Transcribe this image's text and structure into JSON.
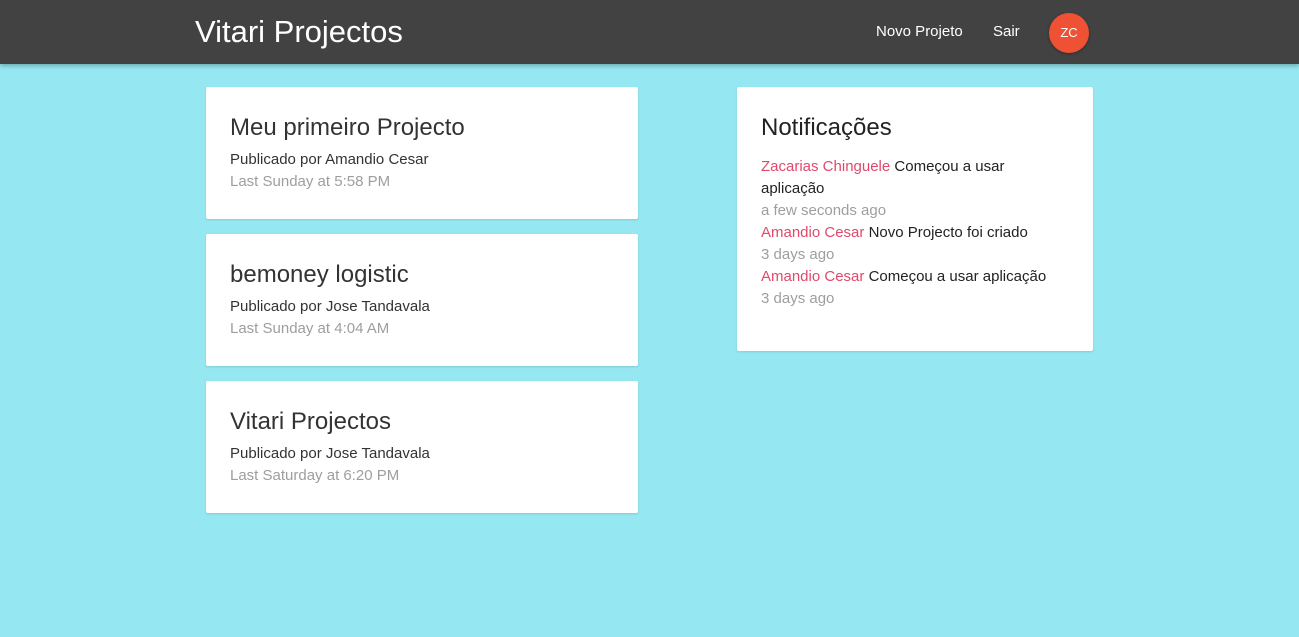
{
  "navbar": {
    "brand": "Vitari Projectos",
    "links": {
      "new_project": "Novo Projeto",
      "logout": "Sair"
    },
    "avatar_initials": "ZC"
  },
  "projects": [
    {
      "title": "Meu primeiro Projecto",
      "author": "Publicado por Amandio Cesar",
      "time": "Last Sunday at 5:58 PM"
    },
    {
      "title": "bemoney logistic",
      "author": "Publicado por Jose Tandavala",
      "time": "Last Sunday at 4:04 AM"
    },
    {
      "title": "Vitari Projectos",
      "author": "Publicado por Jose Tandavala",
      "time": "Last Saturday at 6:20 PM"
    }
  ],
  "notifications": {
    "title": "Notificações",
    "items": [
      {
        "user": "Zacarias Chinguele",
        "text": "Começou a usar aplicação",
        "time": "a few seconds ago"
      },
      {
        "user": "Amandio Cesar",
        "text": "Novo Projecto foi criado",
        "time": "3 days ago"
      },
      {
        "user": "Amandio Cesar",
        "text": "Começou a usar aplicação",
        "time": "3 days ago"
      }
    ]
  },
  "colors": {
    "background": "#95e7f2",
    "navbar": "#424242",
    "avatar": "#ee5133",
    "notification_user": "#e0496b",
    "muted": "#9e9e9e"
  }
}
